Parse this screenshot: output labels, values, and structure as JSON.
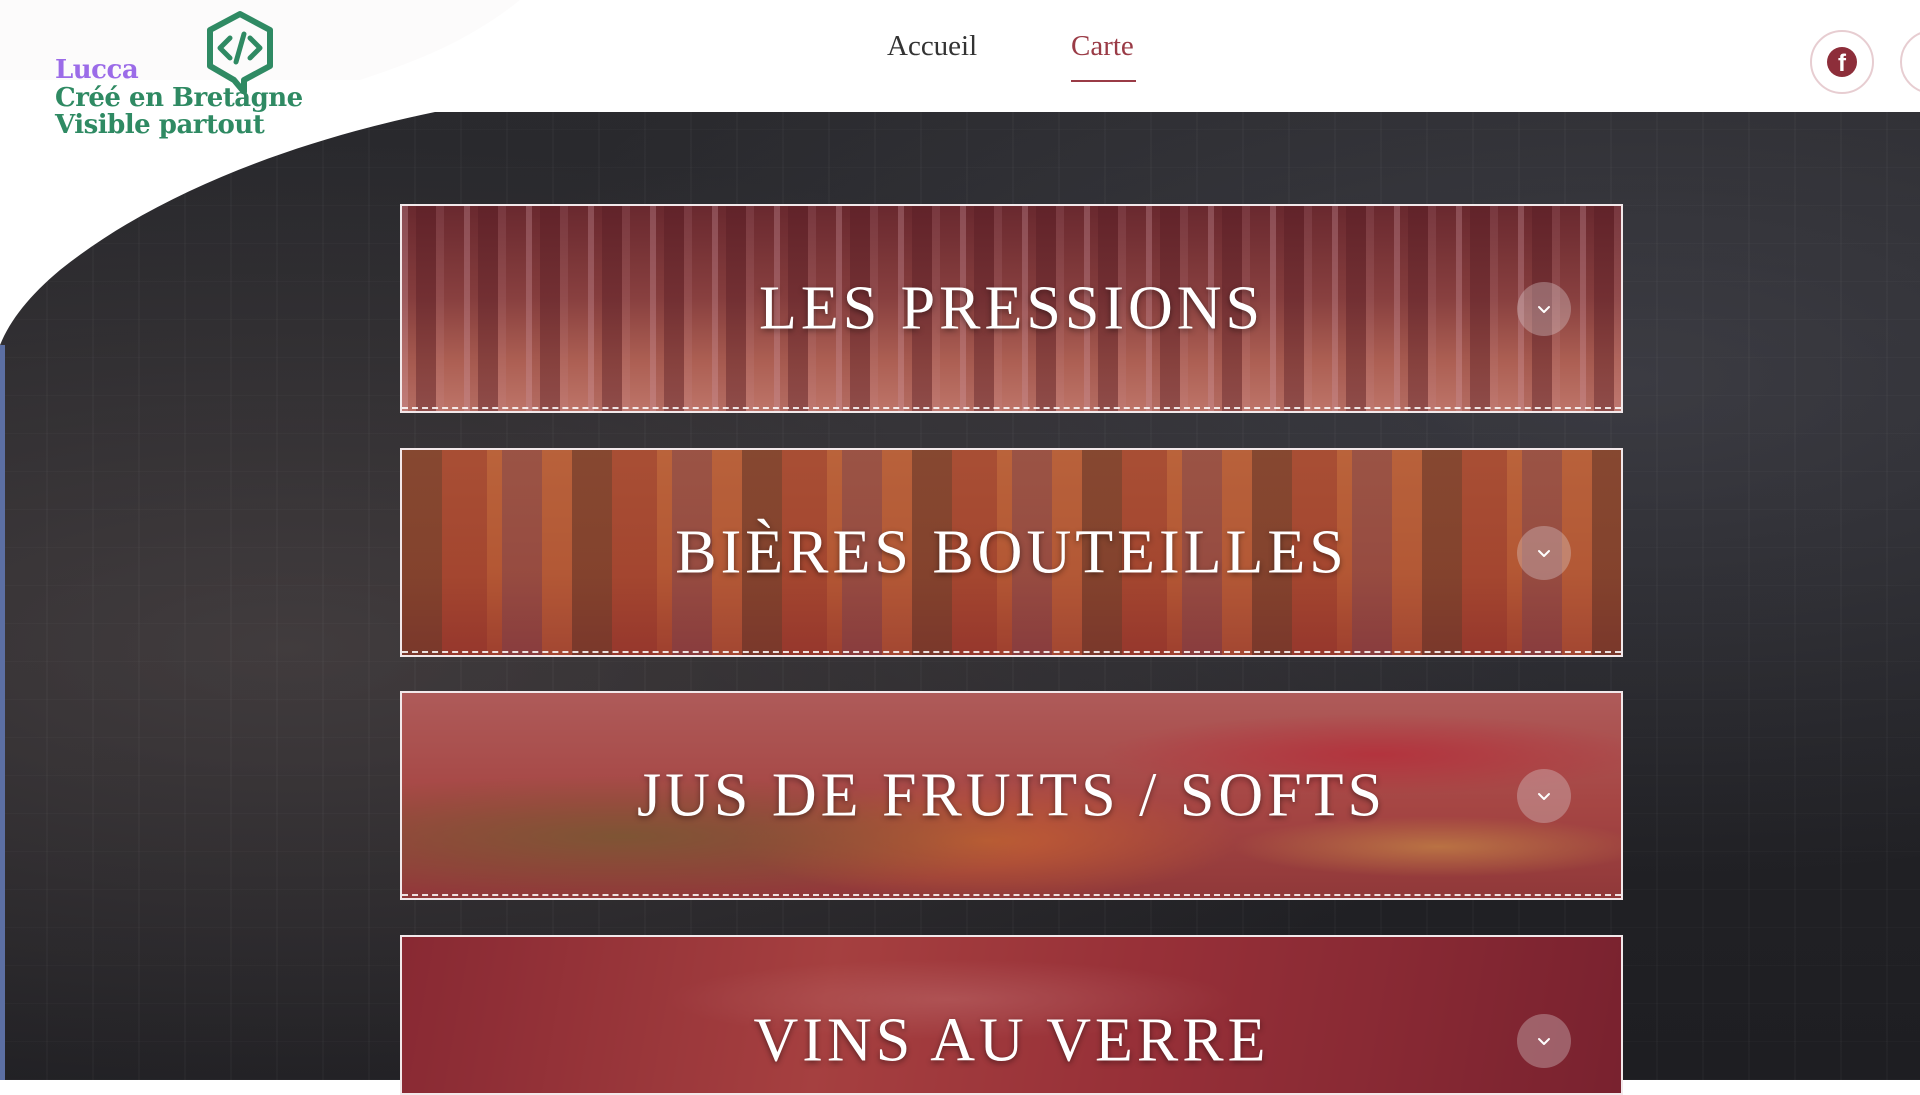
{
  "logo": {
    "line1": "Lucca",
    "line2": "Créé en Bretagne",
    "line3": "Visible partout",
    "icon": "code-speech-bubble-icon"
  },
  "nav": {
    "items": [
      {
        "label": "Accueil",
        "active": false
      },
      {
        "label": "Carte",
        "active": true
      }
    ]
  },
  "social": [
    {
      "icon": "facebook-icon"
    },
    {
      "icon": "social-icon"
    }
  ],
  "menu_sections": [
    {
      "title": "LES PRESSIONS",
      "toggle_icon": "chevron-down-icon"
    },
    {
      "title": "BIÈRES BOUTEILLES",
      "toggle_icon": "chevron-down-icon"
    },
    {
      "title": "JUS DE FRUITS / SOFTS",
      "toggle_icon": "chevron-down-icon"
    },
    {
      "title": "VINS AU VERRE",
      "toggle_icon": "chevron-down-icon"
    }
  ],
  "colors": {
    "accent": "#9a3b46",
    "logo_purple": "#9b6be8",
    "logo_green": "#2f8a63",
    "overlay": "#96283c",
    "hero_dark": "#242428"
  }
}
